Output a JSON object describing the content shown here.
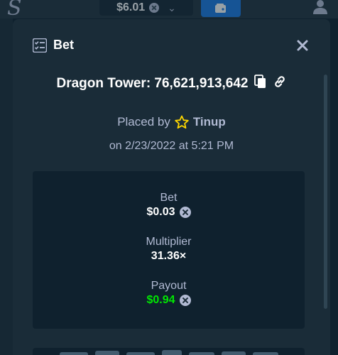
{
  "topbar": {
    "balance": "$6.01",
    "icons": [
      "logo-icon",
      "currency-icon",
      "chevron-down-icon",
      "wallet-icon",
      "user-icon"
    ]
  },
  "modal": {
    "title": "Bet",
    "header_icon": "bet-checklist-icon",
    "close_icon": "close-icon",
    "game_title": "Dragon Tower: 76,621,913,642",
    "copy_icon": "copy-icon",
    "link_icon": "link-icon",
    "placed_by_label": "Placed by",
    "username": "Tinup",
    "vip_icon": "star-icon",
    "date_prefix": "on",
    "date": "2/23/2022",
    "time_joiner": "at",
    "time": "5:21 PM",
    "stats": {
      "bet_label": "Bet",
      "bet_value": "$0.03",
      "multiplier_label": "Multiplier",
      "multiplier_value": "31.36×",
      "payout_label": "Payout",
      "payout_value": "$0.94"
    }
  },
  "colors": {
    "background": "#0f212e",
    "panel": "#1a2c38",
    "muted_text": "#b1bad3",
    "payout_green": "#00e701",
    "accent_blue": "#1475e1",
    "star_yellow": "#ffd700"
  }
}
